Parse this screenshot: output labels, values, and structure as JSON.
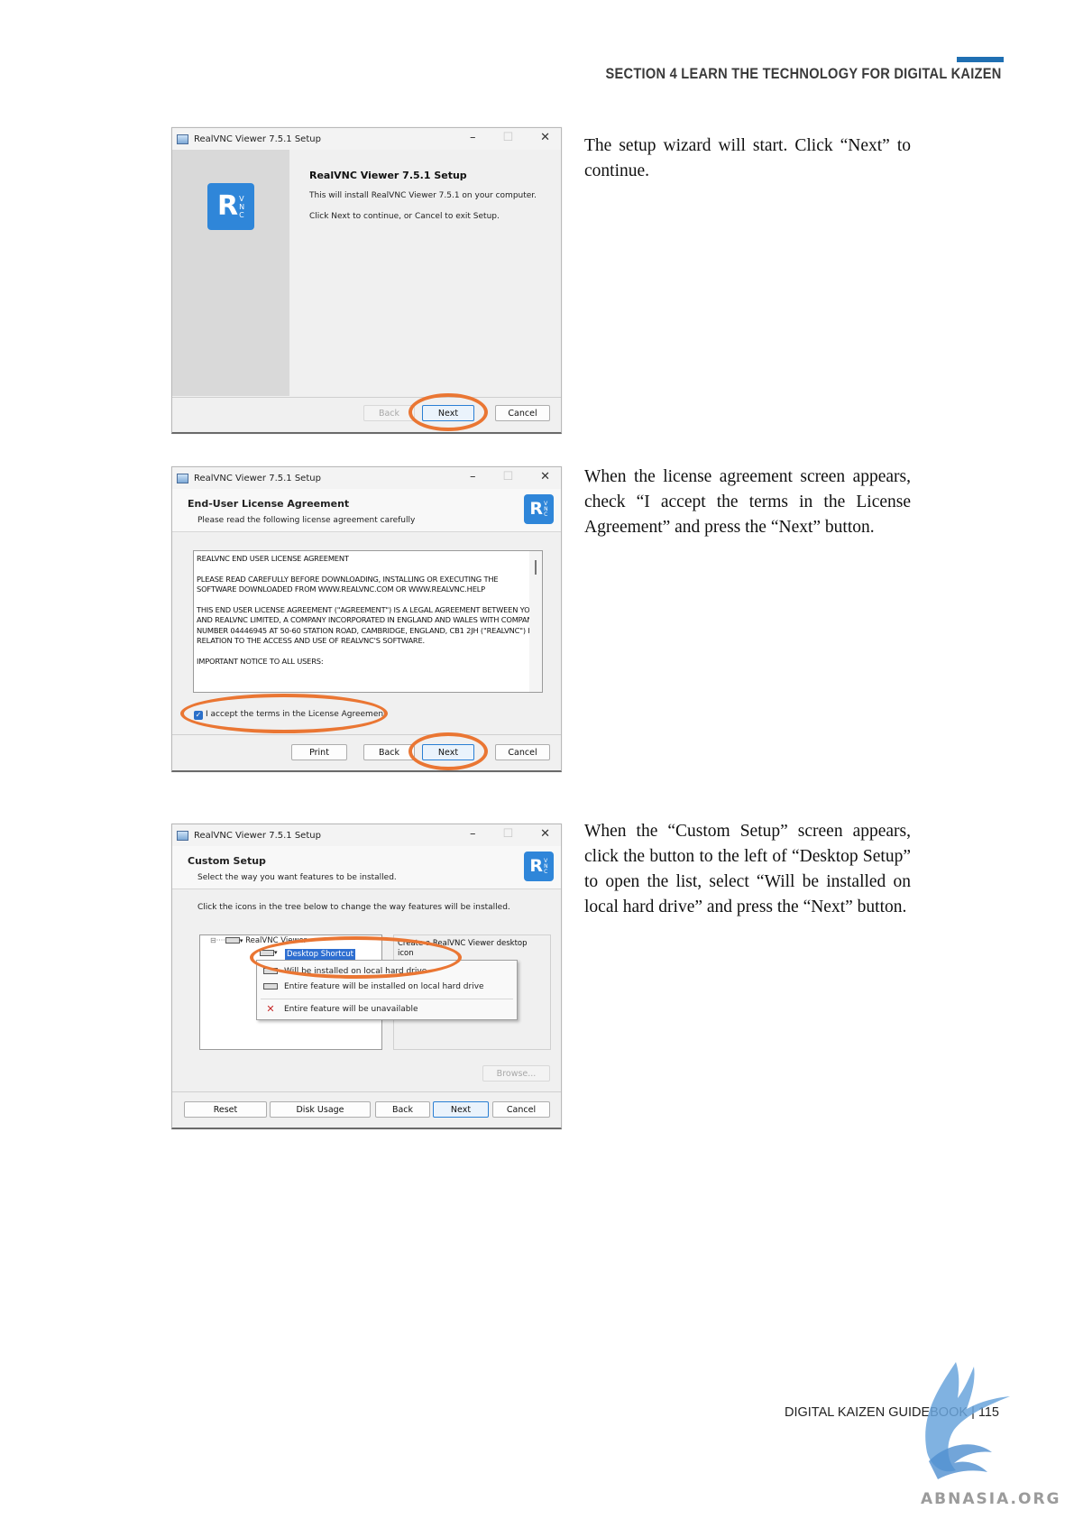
{
  "header": {
    "section": "SECTION 4  LEARN THE TECHNOLOGY FOR DIGITAL KAIZEN"
  },
  "colors": {
    "accent": "#1f6fb2",
    "highlight_ring": "#ea7633",
    "logo_blue": "#2f86d9"
  },
  "steps": [
    {
      "text": "The setup wizard will start. Click “Next” to continue.",
      "window_title": "RealVNC Viewer 7.5.1 Setup",
      "heading": "RealVNC Viewer 7.5.1 Setup",
      "line1": "This will install RealVNC Viewer 7.5.1 on your computer.",
      "line2": "Click Next to continue, or Cancel to exit Setup.",
      "buttons": {
        "back": "Back",
        "next": "Next",
        "cancel": "Cancel"
      }
    },
    {
      "text": "When the license agreement screen appears, check “I accept the terms in the License Agreement” and press the “Next” button.",
      "window_title": "RealVNC Viewer 7.5.1 Setup",
      "heading": "End-User License Agreement",
      "subheading": "Please read the following license agreement carefully",
      "eula": [
        "REALVNC END USER LICENSE AGREEMENT",
        "PLEASE READ CAREFULLY BEFORE DOWNLOADING, INSTALLING OR EXECUTING THE SOFTWARE DOWNLOADED FROM WWW.REALVNC.COM OR WWW.REALVNC.HELP",
        "THIS END USER LICENSE AGREEMENT (\"AGREEMENT\") IS A LEGAL AGREEMENT BETWEEN YOU AND REALVNC LIMITED, A COMPANY INCORPORATED IN ENGLAND AND WALES WITH COMPANY NUMBER 04446945 AT 50-60 STATION ROAD, CAMBRIDGE, ENGLAND, CB1 2JH (\"REALVNC\") IN RELATION TO THE ACCESS AND USE OF REALVNC'S SOFTWARE.",
        "IMPORTANT NOTICE TO ALL USERS:"
      ],
      "checkbox_label": "I accept the terms in the License Agreement",
      "checkbox_checked": true,
      "buttons": {
        "print": "Print",
        "back": "Back",
        "next": "Next",
        "cancel": "Cancel"
      }
    },
    {
      "text": "When the “Custom Setup” screen appears, click the button to the left of “Desktop Setup” to open the list, select “Will be installed on local hard drive” and press the “Next” button.",
      "window_title": "RealVNC Viewer 7.5.1 Setup",
      "heading": "Custom Setup",
      "subheading": "Select the way you want features to be installed.",
      "hint": "Click the icons in the tree below to change the way features will be installed.",
      "tree_root": "RealVNC Viewer",
      "tree_selected": "Desktop Shortcut",
      "feature_desc": "Create a RealVNC Viewer desktop icon",
      "menu": [
        "Will be installed on local hard drive",
        "Entire feature will be installed on local hard drive",
        "Entire feature will be unavailable"
      ],
      "buttons": {
        "browse": "Browse...",
        "reset": "Reset",
        "disk": "Disk Usage",
        "back": "Back",
        "next": "Next",
        "cancel": "Cancel"
      }
    }
  ],
  "footer": {
    "text": "DIGITAL KAIZEN GUIDEBOOK | 115"
  },
  "watermark": {
    "text": "ABNASIA.ORG"
  }
}
